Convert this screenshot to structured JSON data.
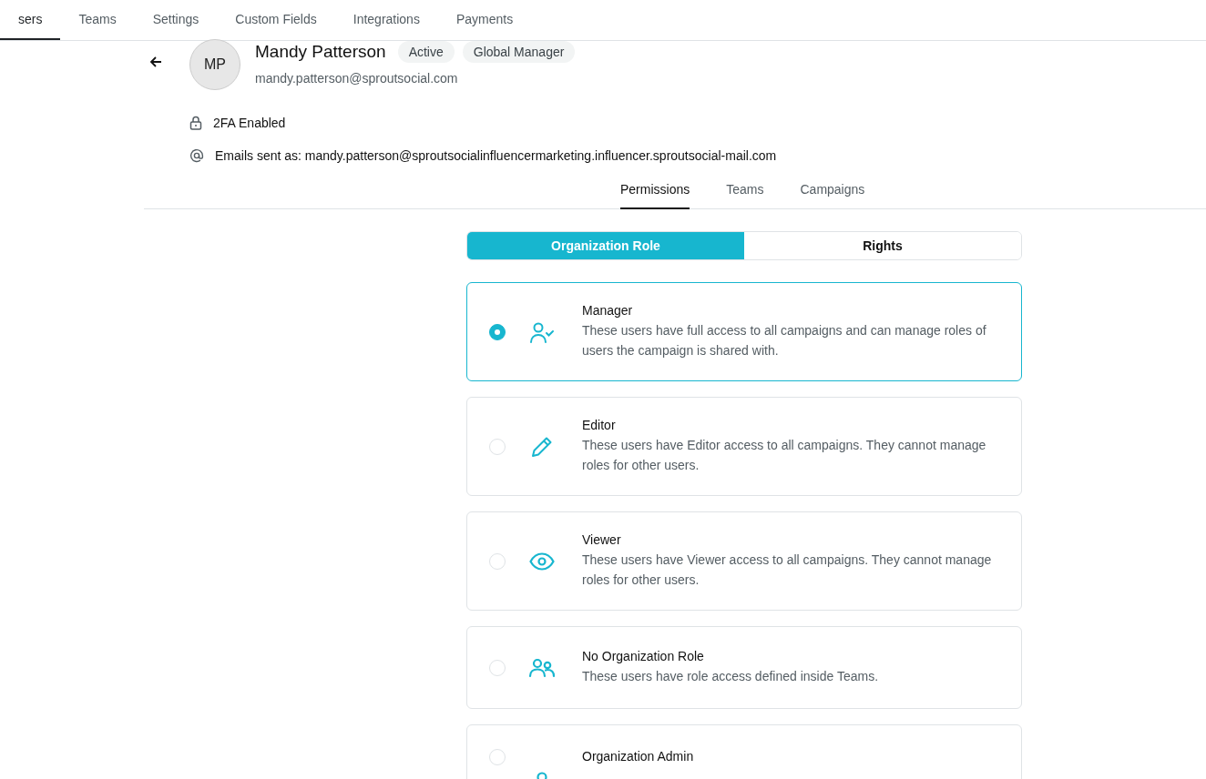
{
  "nav_tabs": [
    {
      "label": "sers",
      "selected": true
    },
    {
      "label": "Teams",
      "selected": false
    },
    {
      "label": "Settings",
      "selected": false
    },
    {
      "label": "Custom Fields",
      "selected": false
    },
    {
      "label": "Integrations",
      "selected": false
    },
    {
      "label": "Payments",
      "selected": false
    }
  ],
  "user": {
    "initials": "MP",
    "name": "Mandy Patterson",
    "badges": [
      "Active",
      "Global Manager"
    ],
    "email": "mandy.patterson@sproutsocial.com"
  },
  "details": [
    {
      "kind": "lock",
      "text": "2FA Enabled"
    },
    {
      "kind": "at",
      "text": "Emails sent as: mandy.patterson@sproutsocialinfluencermarketing.influencer.sproutsocial-mail.com"
    }
  ],
  "sub_tabs": [
    {
      "label": "Permissions",
      "selected": true
    },
    {
      "label": "Teams",
      "selected": false
    },
    {
      "label": "Campaigns",
      "selected": false
    }
  ],
  "segments": [
    {
      "label": "Organization Role",
      "selected": true
    },
    {
      "label": "Rights",
      "selected": false
    }
  ],
  "roles": [
    {
      "kind": "manager",
      "title": "Manager",
      "description": "These users have full access to all campaigns and can manage roles of users the campaign is shared with.",
      "selected": true
    },
    {
      "kind": "editor",
      "title": "Editor",
      "description": "These users have Editor access to all campaigns. They cannot manage roles for other users.",
      "selected": false
    },
    {
      "kind": "viewer",
      "title": "Viewer",
      "description": "These users have Viewer access to all campaigns. They cannot manage roles for other users.",
      "selected": false
    },
    {
      "kind": "none",
      "title": "No Organization Role",
      "description": "These users have role access defined inside Teams.",
      "selected": false
    },
    {
      "kind": "admin",
      "title": "Organization Admin",
      "selected": false
    }
  ]
}
